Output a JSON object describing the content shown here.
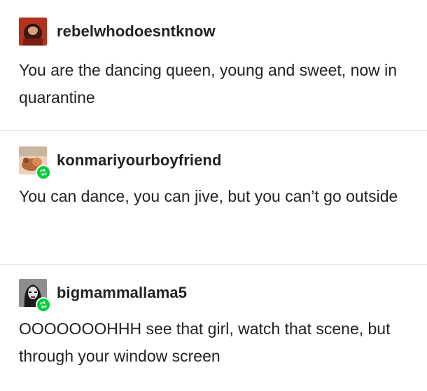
{
  "posts": [
    {
      "username": "rebelwhodoesntknow",
      "text": "You are the dancing queen, young and sweet, now in quarantine",
      "reblog": false
    },
    {
      "username": "konmariyourboyfriend",
      "text": "You can dance, you can jive, but you can’t go outside",
      "reblog": true
    },
    {
      "username": "bigmammallama5",
      "text": "OOOOOOOHHH see that girl, watch that scene, but through your window screen",
      "reblog": true
    }
  ],
  "colors": {
    "reblog_badge": "#00cf35",
    "divider": "#e6e6e6",
    "text": "#222222"
  },
  "icons": {
    "reblog": "reblog-icon"
  }
}
